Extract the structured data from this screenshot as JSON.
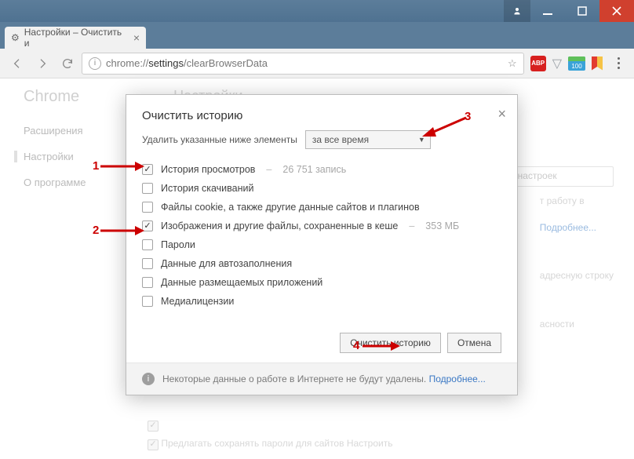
{
  "window": {
    "tab_title": "Настройки – Очистить и",
    "url_prefix": "chrome://",
    "url_host": "settings",
    "url_path": "/clearBrowserData",
    "ext_abp": "ABP",
    "ext_badge": "100"
  },
  "page_bg": {
    "brand": "Chrome",
    "heading": "Настройки",
    "nav": [
      "Расширения",
      "Настройки",
      "О программе"
    ],
    "search_placeholder": "к настроек",
    "right_lines": [
      "т работу в",
      "Подробнее...",
      "адресную строку",
      "асности"
    ],
    "bottom1": "",
    "bottom2": "Предлагать сохранять пароли для сайтов Настроить"
  },
  "dialog": {
    "title": "Очистить историю",
    "time_label": "Удалить указанные ниже элементы",
    "time_value": "за все время",
    "options": [
      {
        "label": "История просмотров",
        "checked": true,
        "suffix": "26 751 запись"
      },
      {
        "label": "История скачиваний",
        "checked": false,
        "suffix": ""
      },
      {
        "label": "Файлы cookie, а также другие данные сайтов и плагинов",
        "checked": false,
        "suffix": ""
      },
      {
        "label": "Изображения и другие файлы, сохраненные в кеше",
        "checked": true,
        "suffix": "353 МБ"
      },
      {
        "label": "Пароли",
        "checked": false,
        "suffix": ""
      },
      {
        "label": "Данные для автозаполнения",
        "checked": false,
        "suffix": ""
      },
      {
        "label": "Данные размещаемых приложений",
        "checked": false,
        "suffix": ""
      },
      {
        "label": "Медиалицензии",
        "checked": false,
        "suffix": ""
      }
    ],
    "clear_btn": "Очистить историю",
    "cancel_btn": "Отмена",
    "footer_text": "Некоторые данные о работе в Интернете не будут удалены.",
    "footer_link": "Подробнее..."
  },
  "anno": {
    "n1": "1",
    "n2": "2",
    "n3": "3",
    "n4": "4"
  }
}
